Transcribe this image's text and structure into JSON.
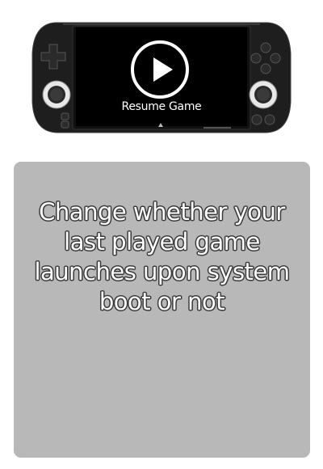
{
  "preview": {
    "action_label": "Resume Game",
    "icons": [
      "play-icon",
      "dpad-icon",
      "face-buttons-icon",
      "analog-stick-icon"
    ]
  },
  "description": {
    "text": "Change whether your\nlast played game\nlaunches upon system\nboot or not"
  },
  "colors": {
    "panel_bg": "#b8b8b8",
    "console_body": "#1e1e1e",
    "screen_bg": "#000000",
    "text": "#ffffff"
  }
}
